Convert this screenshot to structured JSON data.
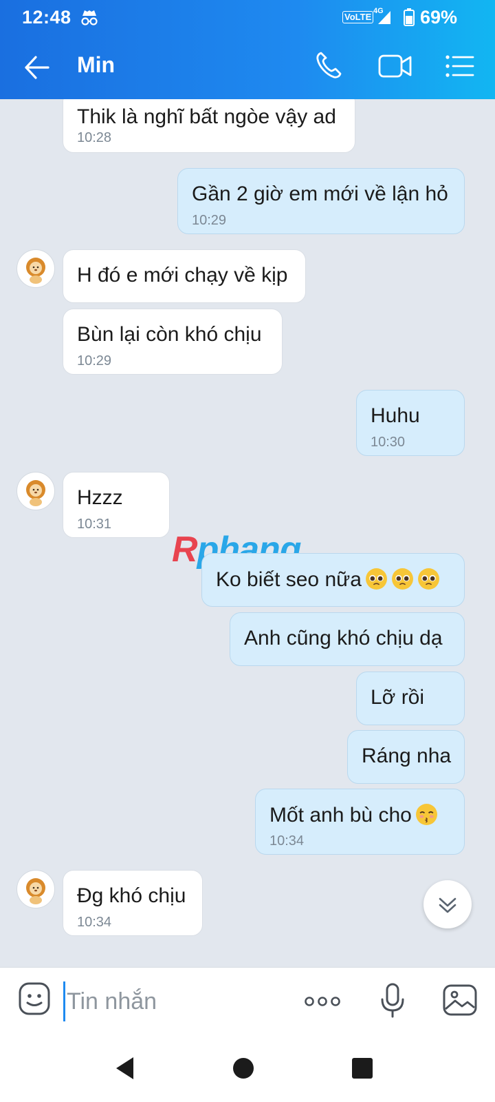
{
  "status_bar": {
    "time": "12:48",
    "volte": "VoLTE",
    "network": "4G",
    "battery_pct": "69%",
    "battery_level": 0.69
  },
  "header": {
    "contact_name": "Min",
    "icons": [
      "back-arrow-icon",
      "phone-icon",
      "video-call-icon",
      "menu-list-icon"
    ]
  },
  "messages": [
    {
      "dir": "in",
      "text": "Thik là nghĩ bất ngòe vậy ad",
      "time": "10:28"
    },
    {
      "dir": "out",
      "text": "Gần 2 giờ em mới về lận hỏ",
      "time": "10:29"
    },
    {
      "dir": "in",
      "text": "H đó e mới chạy về kịp",
      "time": ""
    },
    {
      "dir": "in",
      "text": "Bùn lại còn khó chịu",
      "time": "10:29"
    },
    {
      "dir": "out",
      "text": "Huhu",
      "time": "10:30"
    },
    {
      "dir": "in",
      "text": "Hzzz",
      "time": "10:31"
    },
    {
      "dir": "out",
      "text": "Ko biết seo nữa",
      "time": "",
      "emoji": [
        "pleading-face",
        "pleading-face",
        "pleading-face"
      ]
    },
    {
      "dir": "out",
      "text": "Anh cũng khó chịu dạ",
      "time": ""
    },
    {
      "dir": "out",
      "text": "Lỡ rồi",
      "time": ""
    },
    {
      "dir": "out",
      "text": "Ráng nha",
      "time": ""
    },
    {
      "dir": "out",
      "text": "Mốt anh bù cho",
      "time": "10:34",
      "emoji": [
        "kissing-face"
      ]
    },
    {
      "dir": "in",
      "text": "Đg khó chịu",
      "time": "10:34"
    }
  ],
  "watermark": {
    "first": "R",
    "rest": "phang"
  },
  "composer": {
    "placeholder": "Tin nhắn",
    "icons": [
      "emoji-icon",
      "more-dots-icon",
      "microphone-icon",
      "image-icon"
    ]
  },
  "colors": {
    "header_start": "#1a6fe0",
    "header_end": "#12b6f2",
    "outgoing_bubble": "#d6edfc",
    "incoming_bubble": "#ffffff",
    "chat_bg": "#e2e7ee"
  }
}
